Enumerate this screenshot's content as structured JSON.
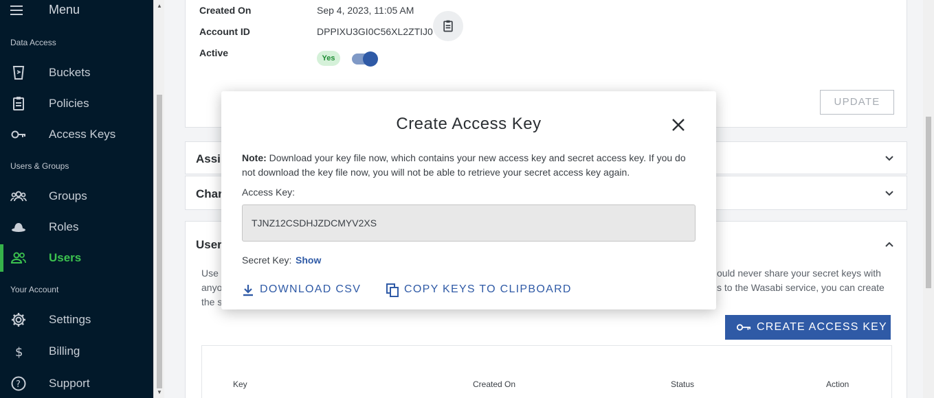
{
  "sidebar": {
    "menu_label": "Menu",
    "sections": {
      "data_access": "Data Access",
      "users_groups": "Users & Groups",
      "your_account": "Your Account"
    },
    "items": {
      "buckets": "Buckets",
      "policies": "Policies",
      "access_keys": "Access Keys",
      "groups": "Groups",
      "roles": "Roles",
      "users": "Users",
      "settings": "Settings",
      "billing": "Billing",
      "support": "Support"
    },
    "active_item": "users",
    "active_color": "#36b24a"
  },
  "details": {
    "created_on_label": "Created On",
    "created_on_value": "Sep 4, 2023, 11:05 AM",
    "account_id_label": "Account ID",
    "account_id_value": "DPPIXU3GI0C56XL2ZTIJ0",
    "active_label": "Active",
    "active_badge": "Yes",
    "active_toggle_on": true,
    "update_button": "UPDATE"
  },
  "sections": {
    "assigned_partial": "Assi",
    "change_partial": "Char",
    "users_partial": "User"
  },
  "keys_panel": {
    "paragraph_left": [
      "Use a",
      "anyo",
      "the s"
    ],
    "paragraph_right": [
      "ould never share your secret keys with",
      "s to the Wasabi service, you can create"
    ],
    "create_button": "CREATE ACCESS KEY",
    "columns": [
      "Key",
      "Created On",
      "Status",
      "Action"
    ]
  },
  "modal": {
    "title": "Create Access Key",
    "note_label": "Note:",
    "note_text": " Download your key file now, which contains your new access key and secret access key. If you do not download the key file now, you will not be able to retrieve your secret access key again.",
    "access_key_label": "Access Key:",
    "access_key_value": "TJNZ12CSDHJZDCMYV2XS",
    "secret_key_label": "Secret Key:",
    "secret_key_show": "Show",
    "download_csv": "DOWNLOAD CSV",
    "copy_keys": "COPY KEYS TO CLIPBOARD",
    "accent": "#2f5aa6"
  }
}
